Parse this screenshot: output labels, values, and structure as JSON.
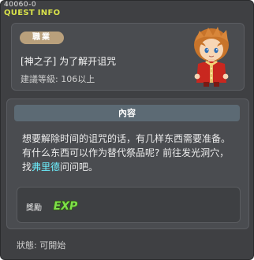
{
  "window": {
    "quest_id": "40060-0",
    "title": "QUEST INFO"
  },
  "quest": {
    "job_label": "職業",
    "name": "[神之子] 为了解开诅咒",
    "level_text": "建議等級: 106以上"
  },
  "content": {
    "header": "內容",
    "line1": "想要解除时间的诅咒的话，有几样东西需要准备。",
    "line2": "有什么东西可以作为替代祭品呢? 前往发光洞穴，",
    "line3_prefix": "找",
    "npc_name": "弗里德",
    "line3_suffix": "问问吧。"
  },
  "reward": {
    "label": "獎勵",
    "exp_text": "EXP",
    "icon": "exp-icon"
  },
  "status": {
    "text": "狀態:  可開始"
  },
  "colors": {
    "title": "#d9e24a",
    "npc_highlight": "#6cf0ff",
    "badge": "#b9a07c",
    "exp": "#7ee04a"
  }
}
